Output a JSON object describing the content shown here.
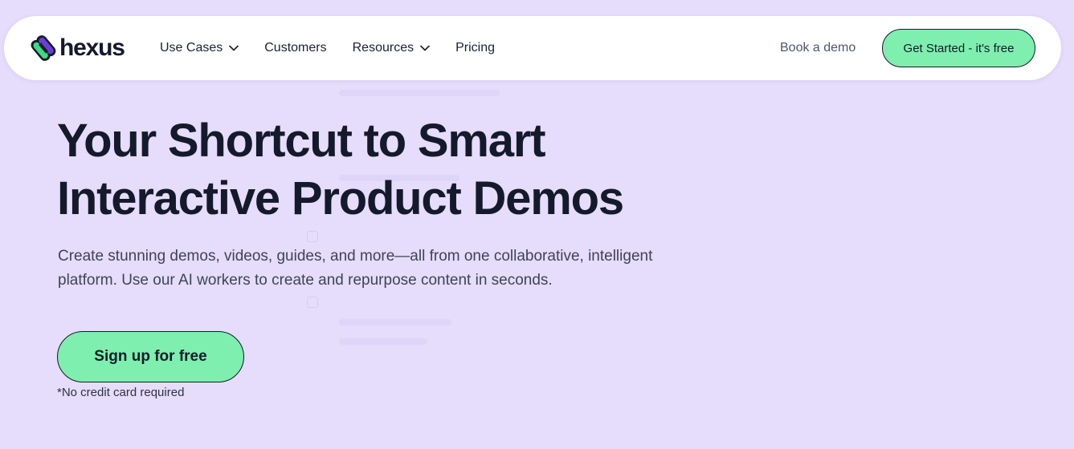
{
  "colors": {
    "page_background": "#e6dcfb",
    "nav_background": "#ffffff",
    "cta_green": "#7eefae",
    "text_dark": "#141a2b",
    "logo_green": "#3ddc84",
    "logo_purple": "#6b3fd4"
  },
  "nav": {
    "brand": "hexus",
    "logo_icon": "hexus-logo-icon",
    "items": [
      {
        "label": "Use Cases",
        "has_dropdown": true,
        "icon": "chevron-down-icon"
      },
      {
        "label": "Customers",
        "has_dropdown": false
      },
      {
        "label": "Resources",
        "has_dropdown": true,
        "icon": "chevron-down-icon"
      },
      {
        "label": "Pricing",
        "has_dropdown": false
      }
    ],
    "book_demo": "Book a demo",
    "get_started": "Get Started - it's free"
  },
  "hero": {
    "title_line1": "Your Shortcut to Smart",
    "title_line2": "Interactive Product Demos",
    "subtitle": "Create stunning demos, videos, guides, and more—all from one collaborative, intelligent platform. Use our AI workers to create and repurpose content in seconds.",
    "cta": "Sign up for free",
    "note": "*No credit card required"
  }
}
